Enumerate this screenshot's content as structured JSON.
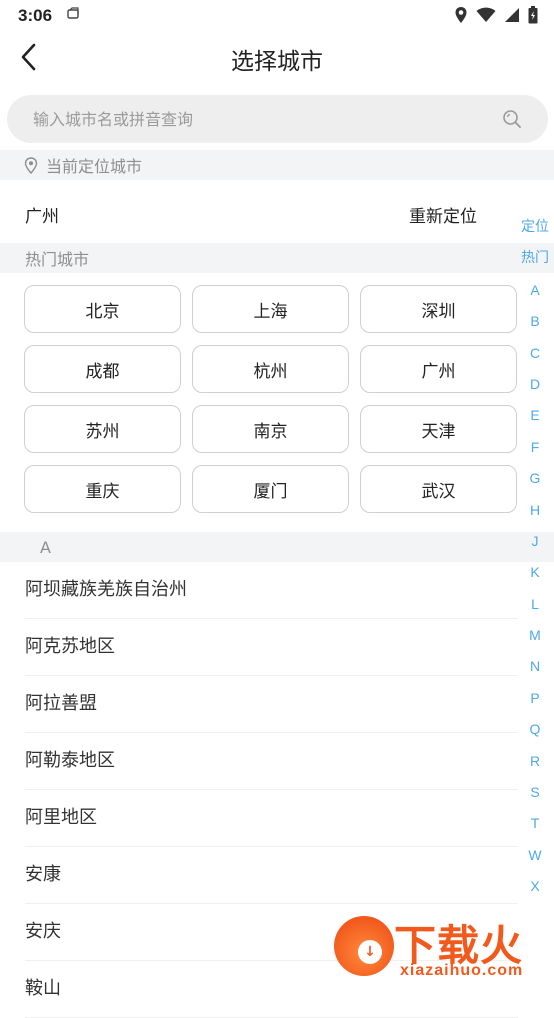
{
  "status_bar": {
    "time": "3:06"
  },
  "header": {
    "title": "选择城市"
  },
  "search": {
    "placeholder": "输入城市名或拼音查询"
  },
  "location_section": {
    "label": "当前定位城市",
    "current_city": "广州",
    "relocate_label": "重新定位"
  },
  "hot_section": {
    "label": "热门城市",
    "cities": [
      "北京",
      "上海",
      "深圳",
      "成都",
      "杭州",
      "广州",
      "苏州",
      "南京",
      "天津",
      "重庆",
      "厦门",
      "武汉"
    ]
  },
  "a_section": {
    "letter": "A",
    "cities": [
      "阿坝藏族羌族自治州",
      "阿克苏地区",
      "阿拉善盟",
      "阿勒泰地区",
      "阿里地区",
      "安康",
      "安庆",
      "鞍山"
    ]
  },
  "index_bar": [
    "定位",
    "热门",
    "A",
    "B",
    "C",
    "D",
    "E",
    "F",
    "G",
    "H",
    "J",
    "K",
    "L",
    "M",
    "N",
    "P",
    "Q",
    "R",
    "S",
    "T",
    "W",
    "X"
  ],
  "watermark": {
    "text": "下载火",
    "url": "xiazaihuo.com"
  },
  "colors": {
    "accent": "#4fa8e8",
    "section_bg": "#f3f4f6",
    "watermark": "#f25a1d"
  }
}
